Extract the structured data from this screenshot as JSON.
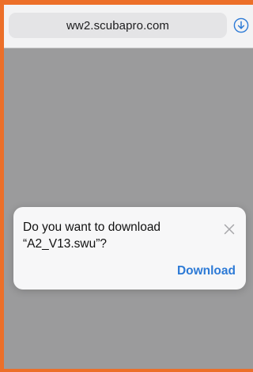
{
  "browser": {
    "url": "ww2.scubapro.com",
    "download_icon": "download-circle-icon"
  },
  "dialog": {
    "message_line1": "Do you want to download",
    "message_line2": "“A2_V13.swu”?",
    "close_icon": "close-icon",
    "download_label": "Download"
  },
  "colors": {
    "accent": "#2d7ad6",
    "frame_border": "#ec6f29",
    "page_overlay": "#9b9b9c"
  }
}
